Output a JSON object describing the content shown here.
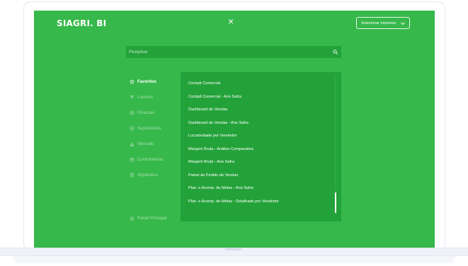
{
  "header": {
    "logo": "SIAGRI. BI",
    "close_glyph": "×",
    "company_select": {
      "label": "Selecionar empresa",
      "icon": "chevron-down-icon"
    }
  },
  "search": {
    "placeholder": "Pesquisar",
    "icon": "search-icon"
  },
  "sidebar": {
    "items": [
      {
        "label": "Favoritos",
        "icon": "star-icon",
        "active": true
      },
      {
        "label": "Lavoura",
        "icon": "seed-icon"
      },
      {
        "label": "Finanças",
        "icon": "coin-icon"
      },
      {
        "label": "Suprimentos",
        "icon": "box-icon"
      },
      {
        "label": "Mercado",
        "icon": "bar-chart-icon"
      },
      {
        "label": "Controladoria",
        "icon": "briefcase-icon"
      },
      {
        "label": "Algodoeira",
        "icon": "cotton-icon"
      }
    ],
    "bottom_item": {
      "label": "Painel Principal",
      "icon": "home-icon"
    }
  },
  "reports": {
    "items": [
      "Cockpit Comercial",
      "Cockpit Comercial - Ano Safra",
      "Dashboard de Vendas",
      "Dashboard de Vendas - Ano Safra",
      "Lucratividade por Vendedor",
      "Margem Bruta - Análise Comparativa",
      "Margem Bruta - Ano Safra",
      "Painel de Pedido de Vendas",
      "Plan. e Acomp. de Metas - Ano Safra",
      "Plan. e Acomp. de Metas - Detalhado por Vendedor"
    ]
  },
  "colors": {
    "background": "#36b84a",
    "panel": "#24a23a",
    "text": "#ffffff",
    "muted_text": "#a6dfaf"
  }
}
